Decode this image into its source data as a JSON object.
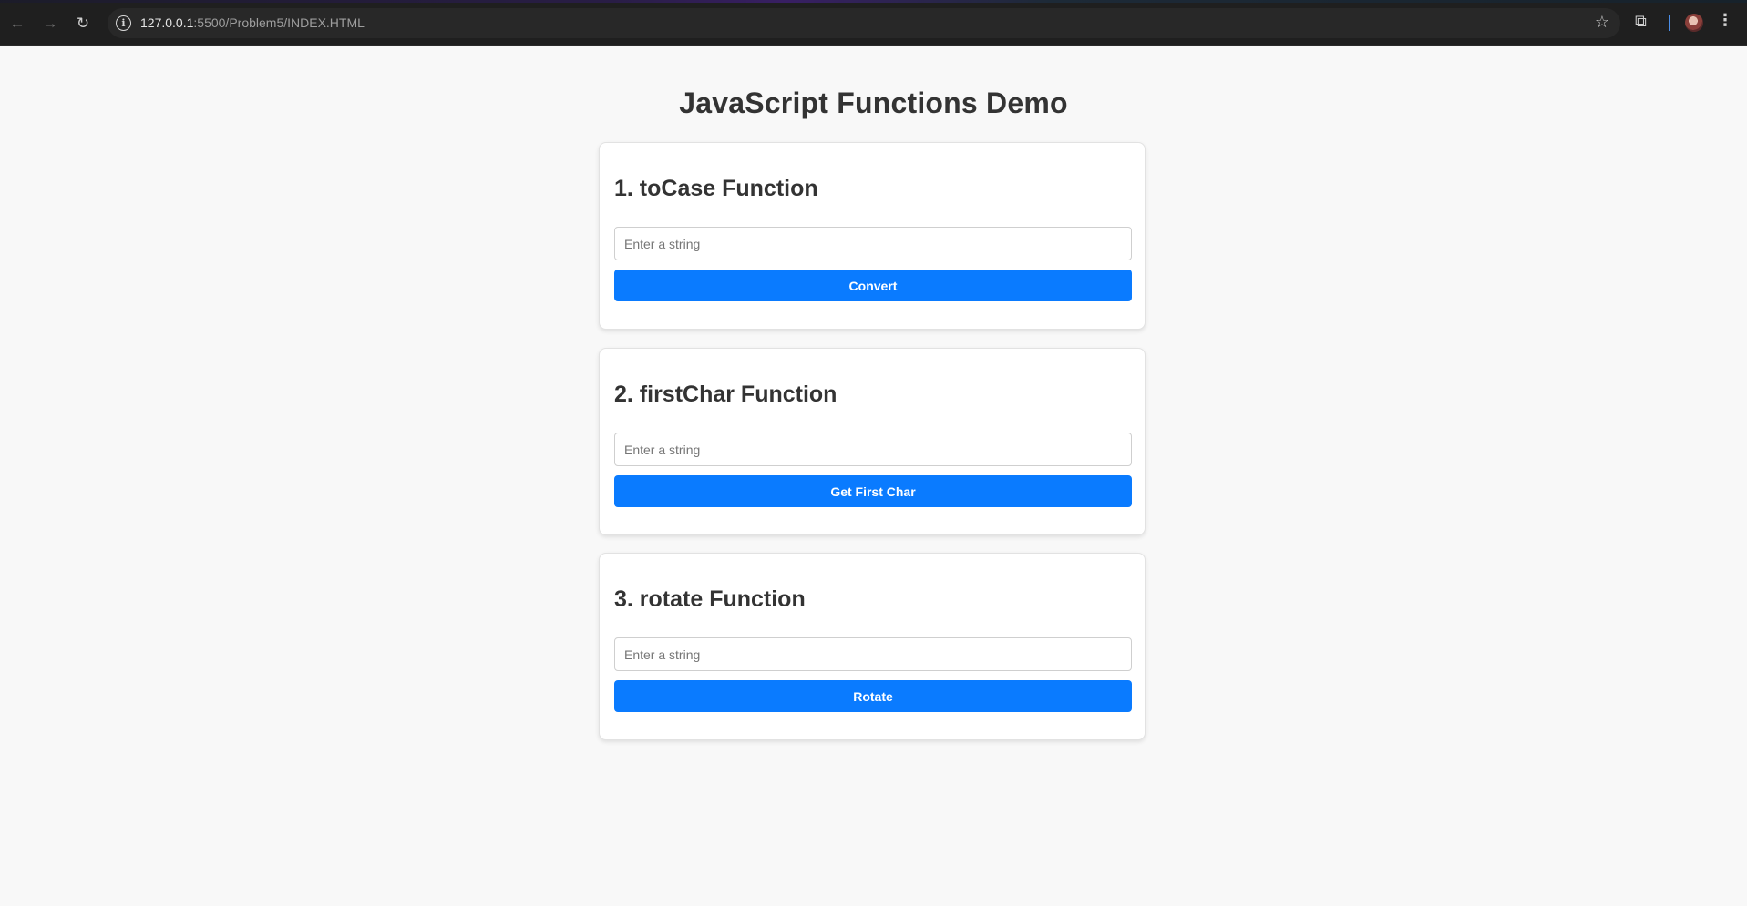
{
  "browser": {
    "url_host": "127.0.0.1",
    "url_path": ":5500/Problem5/INDEX.HTML",
    "icons": {
      "back": "arrow-left",
      "forward": "arrow-right",
      "reload": "reload",
      "site_info": "info",
      "bookmark": "star",
      "extensions": "puzzle",
      "profile": "avatar",
      "menu": "vertical-dots"
    }
  },
  "page": {
    "title": "JavaScript Functions Demo",
    "accent_color": "#0a7bff",
    "sections": [
      {
        "heading": "1. toCase Function",
        "input_placeholder": "Enter a string",
        "input_value": "",
        "button_label": "Convert"
      },
      {
        "heading": "2. firstChar Function",
        "input_placeholder": "Enter a string",
        "input_value": "",
        "button_label": "Get First Char"
      },
      {
        "heading": "3. rotate Function",
        "input_placeholder": "Enter a string",
        "input_value": "",
        "button_label": "Rotate"
      }
    ]
  }
}
